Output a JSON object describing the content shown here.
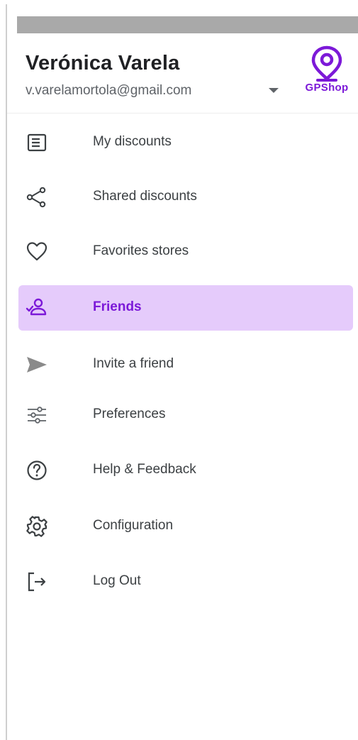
{
  "header": {
    "user_name": "Verónica Varela",
    "user_email": "v.varelamortola@gmail.com",
    "logo_text": "GPShop",
    "dropdown_icon": "caret-down-icon"
  },
  "menu": {
    "items": [
      {
        "label": "My discounts",
        "icon": "document-list-icon",
        "active": false
      },
      {
        "label": "Shared discounts",
        "icon": "share-icon",
        "active": false
      },
      {
        "label": "Favorites stores",
        "icon": "heart-icon",
        "active": false
      },
      {
        "label": "Friends",
        "icon": "friends-icon",
        "active": true
      },
      {
        "label": "Invite a friend",
        "icon": "send-icon",
        "active": false
      },
      {
        "label": "Preferences",
        "icon": "sliders-icon",
        "active": false
      },
      {
        "label": "Help & Feedback",
        "icon": "help-icon",
        "active": false
      },
      {
        "label": "Configuration",
        "icon": "gear-icon",
        "active": false
      },
      {
        "label": "Log Out",
        "icon": "logout-icon",
        "active": false
      }
    ]
  },
  "colors": {
    "accent": "#7c19d8",
    "active_background": "#e5cbfb",
    "text": "#3c4043",
    "icon": "#5f6368"
  }
}
